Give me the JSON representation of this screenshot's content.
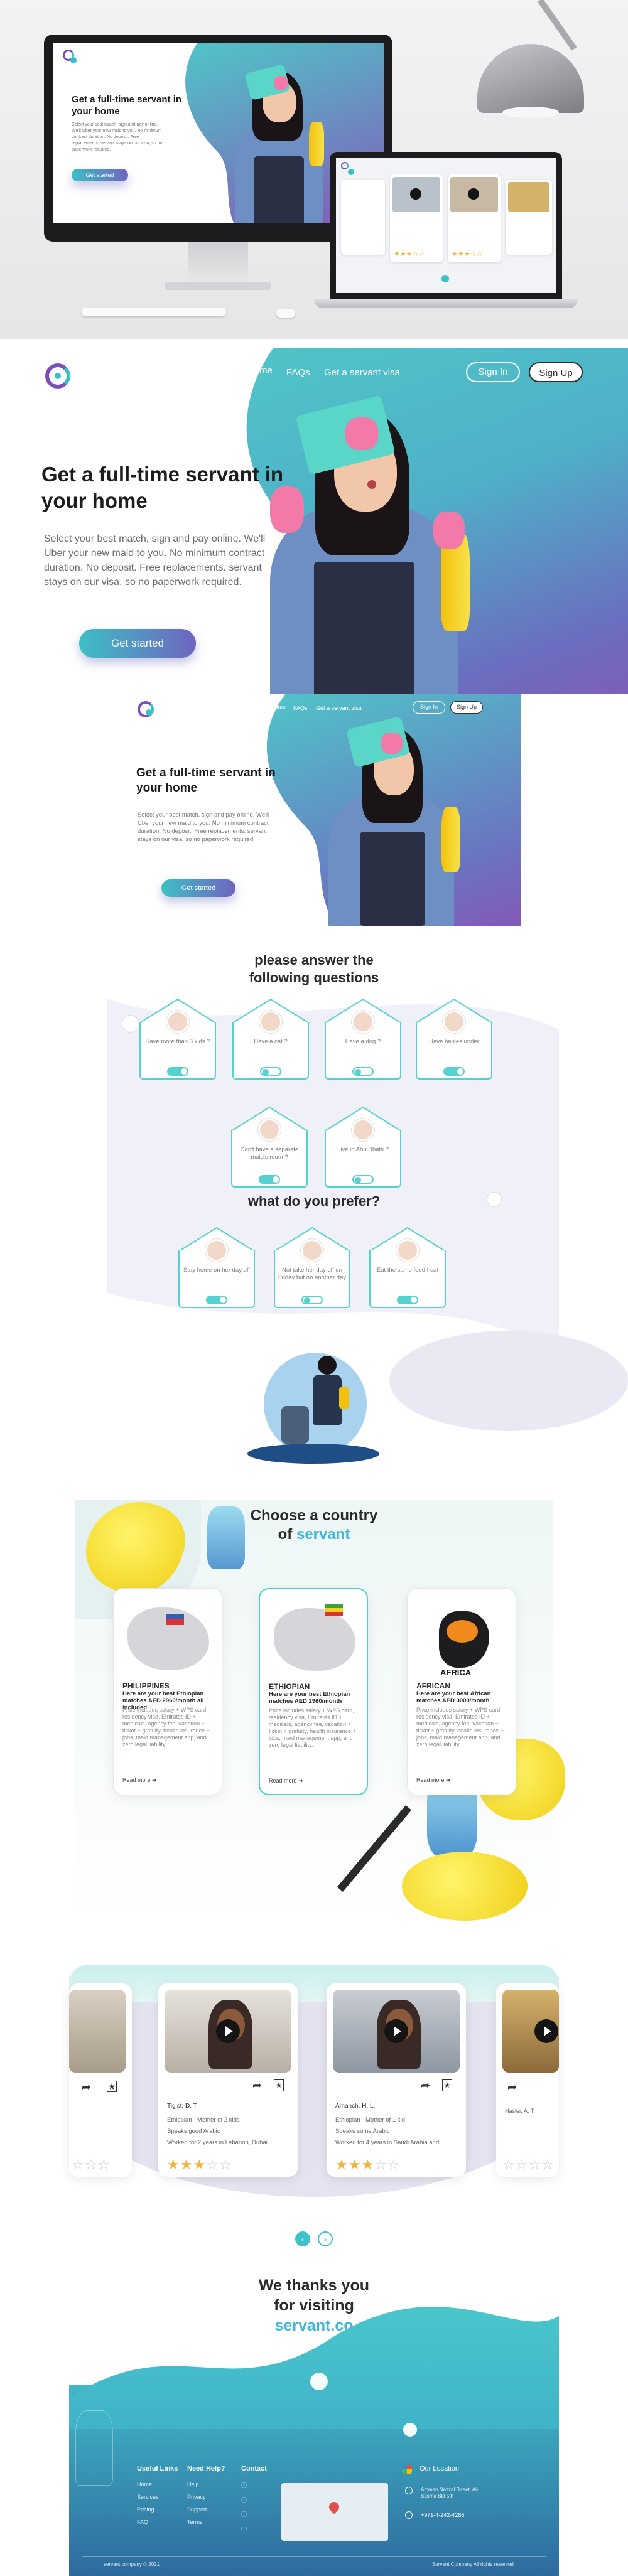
{
  "colors": {
    "teal": "#4fc7c8",
    "purple": "#8458b8",
    "accent_blue": "#3fb7d9",
    "yellow": "#f4c20d",
    "pink": "#f37aa8"
  },
  "nav": {
    "home": "Home",
    "faqs": "FAQs",
    "visa": "Get a servant visa",
    "sign_in": "Sign In",
    "sign_up": "Sign Up"
  },
  "hero": {
    "title": "Get a full-time servant in your home",
    "body": "Select your best match, sign and pay online. We'll Uber your new maid to you. No minimum contract duration. No deposit. Free replacements. servant stays on our visa, so no paperwork required.",
    "cta": "Get started"
  },
  "questions": {
    "title": "please answer the following questions",
    "items": [
      {
        "label": "Have more than 3 kids ?",
        "on": true
      },
      {
        "label": "Have a cat ?",
        "on": false
      },
      {
        "label": "Have a dog ?",
        "on": false
      },
      {
        "label": "Have babies under",
        "on": true
      },
      {
        "label": "Don't have a separate maid's room ?",
        "on": true
      },
      {
        "label": "Live in Abu Dhabi ?",
        "on": false
      }
    ]
  },
  "prefer": {
    "title": "what do you prefer?",
    "items": [
      {
        "label": "Stay home on her day off",
        "on": true
      },
      {
        "label": "Not take her day off on Friday but on another day",
        "on": false
      },
      {
        "label": "Eat the same food I eat",
        "on": true
      }
    ]
  },
  "countries": {
    "title_line1": "Choose a country",
    "title_line2": "of",
    "title_accent": "servant",
    "cards": [
      {
        "name": "PHILIPPINES",
        "sub": "Here are your best Ethiopian matches AED 2960/month all included",
        "desc": "Price includes salary + WPS card, residency visa, Emirates ID + medicals, agency fee, vacation + ticket + gratuity, health insurance + jobs, maid management app, and zero legal liability.",
        "more": "Read more",
        "selected": false
      },
      {
        "name": "ETHIOPIAN",
        "sub": "Here are your best Ethiopian matches AED 2960/month",
        "desc": "Price includes salary + WPS card, residency visa, Emirates ID + medicals, agency fee, vacation + ticket + gratuity, health insurance + jobs, maid management app, and zero legal liability.",
        "more": "Read more",
        "selected": true
      },
      {
        "name": "AFRICAN",
        "sub": "Here are your best African matches AED 3000/month",
        "desc": "Price includes salary + WPS card, residency visa, Emirates ID + medicals, agency fee, vacation + ticket + gratuity, health insurance + jobs, maid management app, and zero legal liability.",
        "more": "Read more",
        "selected": false
      },
      {
        "name": "AFRICA"
      }
    ]
  },
  "candidates": [
    {
      "name": "Tigist, D. T",
      "line1": "Ethiopian - Mother of 2 kids",
      "line2": "Speaks good Arabic",
      "line3": "Worked for 2 years in Lebanon, Dubai",
      "rating": 3
    },
    {
      "name": "Amanch, H. L.",
      "line1": "Ethiopian - Mother of 1 kid",
      "line2": "Speaks some Arabic",
      "line3": "Worked for 4 years in Saudi Arabia and",
      "rating": 3
    }
  ],
  "thanks": {
    "line1": "We thanks you",
    "line2": "for visiting",
    "accent": "servant.co"
  },
  "footer": {
    "col1_title": "Useful Links",
    "col1": [
      "Home",
      "Services",
      "Pricing",
      "FAQ"
    ],
    "col2_title": "Need Help?",
    "col2": [
      "Help",
      "Privacy",
      "Support",
      "Terms"
    ],
    "col3_title": "Contact",
    "location_title": "Our Location",
    "address": "Amman Nazzal Street, Al-Basma Bld 5th",
    "phone": "+971-4-242-4286",
    "copyright": "servant company © 2021",
    "rights": "Servant Company All rights reserved"
  }
}
